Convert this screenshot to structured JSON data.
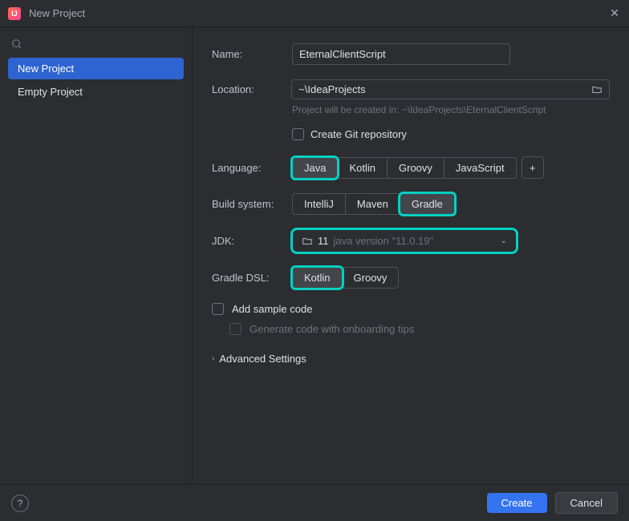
{
  "titlebar": {
    "title": "New Project"
  },
  "sidebar": {
    "items": [
      {
        "label": "New Project",
        "selected": true
      },
      {
        "label": "Empty Project",
        "selected": false
      }
    ]
  },
  "form": {
    "name_label": "Name:",
    "name_value": "EternalClientScript",
    "location_label": "Location:",
    "location_value": "~\\IdeaProjects",
    "location_hint": "Project will be created in: ~\\IdeaProjects\\EternalClientScript",
    "git_label": "Create Git repository",
    "language_label": "Language:",
    "languages": [
      "Java",
      "Kotlin",
      "Groovy",
      "JavaScript"
    ],
    "language_selected": "Java",
    "build_label": "Build system:",
    "build_systems": [
      "IntelliJ",
      "Maven",
      "Gradle"
    ],
    "build_selected": "Gradle",
    "jdk_label": "JDK:",
    "jdk_version": "11",
    "jdk_detail": "java version \"11.0.19\"",
    "dsl_label": "Gradle DSL:",
    "dsl_options": [
      "Kotlin",
      "Groovy"
    ],
    "dsl_selected": "Kotlin",
    "sample_label": "Add sample code",
    "onboarding_label": "Generate code with onboarding tips",
    "advanced_label": "Advanced Settings"
  },
  "footer": {
    "create": "Create",
    "cancel": "Cancel"
  }
}
